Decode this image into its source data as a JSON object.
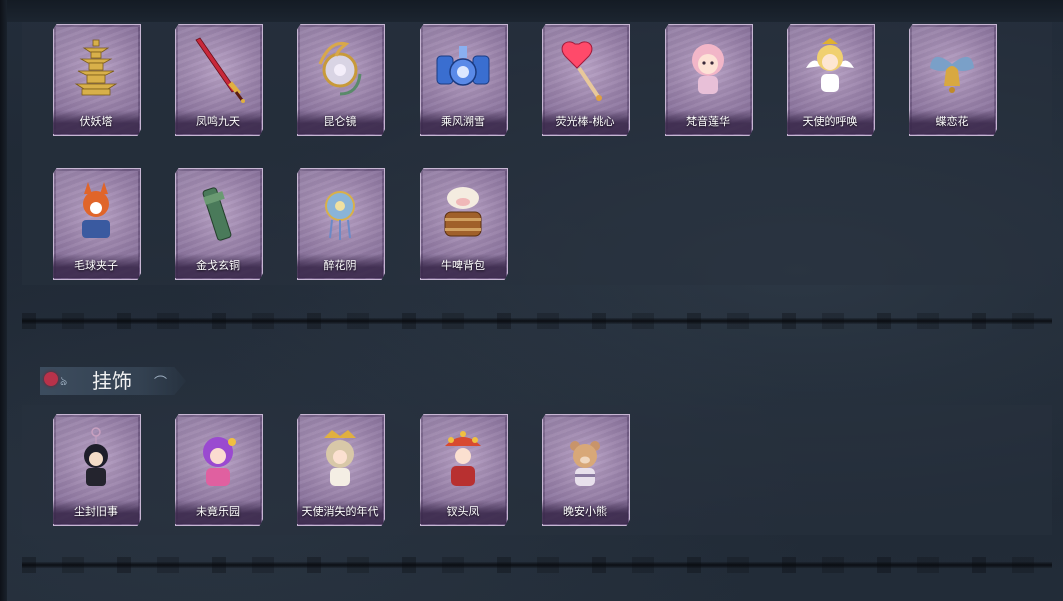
{
  "sections": {
    "items_row1": [
      {
        "label": "伏妖塔",
        "icon": "pagoda-icon"
      },
      {
        "label": "凤鸣九天",
        "icon": "red-sword-icon"
      },
      {
        "label": "昆仑镜",
        "icon": "ornate-mirror-icon"
      },
      {
        "label": "乘风溯雪",
        "icon": "blue-lanterns-icon"
      },
      {
        "label": "荧光棒-桃心",
        "icon": "heart-wand-icon"
      },
      {
        "label": "梵音莲华",
        "icon": "pink-girl-figure-icon"
      },
      {
        "label": "天使的呼唤",
        "icon": "angel-figure-icon"
      },
      {
        "label": "蝶恋花",
        "icon": "butterfly-bell-icon"
      }
    ],
    "items_row2": [
      {
        "label": "毛球夹子",
        "icon": "fox-drummer-icon"
      },
      {
        "label": "金戈玄铜",
        "icon": "bronze-weapon-icon"
      },
      {
        "label": "醉花阴",
        "icon": "flower-ornament-icon"
      },
      {
        "label": "牛啤背包",
        "icon": "cow-beer-barrel-icon"
      }
    ],
    "charms": {
      "title": "挂饰",
      "items": [
        {
          "label": "尘封旧事",
          "icon": "dark-boy-keychain-icon"
        },
        {
          "label": "未竟乐园",
          "icon": "purple-girl-keychain-icon"
        },
        {
          "label": "天使消失的年代",
          "icon": "angel-girl-keychain-icon"
        },
        {
          "label": "钗头凤",
          "icon": "phoenix-headdress-keychain-icon"
        },
        {
          "label": "晚安小熊",
          "icon": "bear-keychain-icon"
        }
      ]
    }
  }
}
